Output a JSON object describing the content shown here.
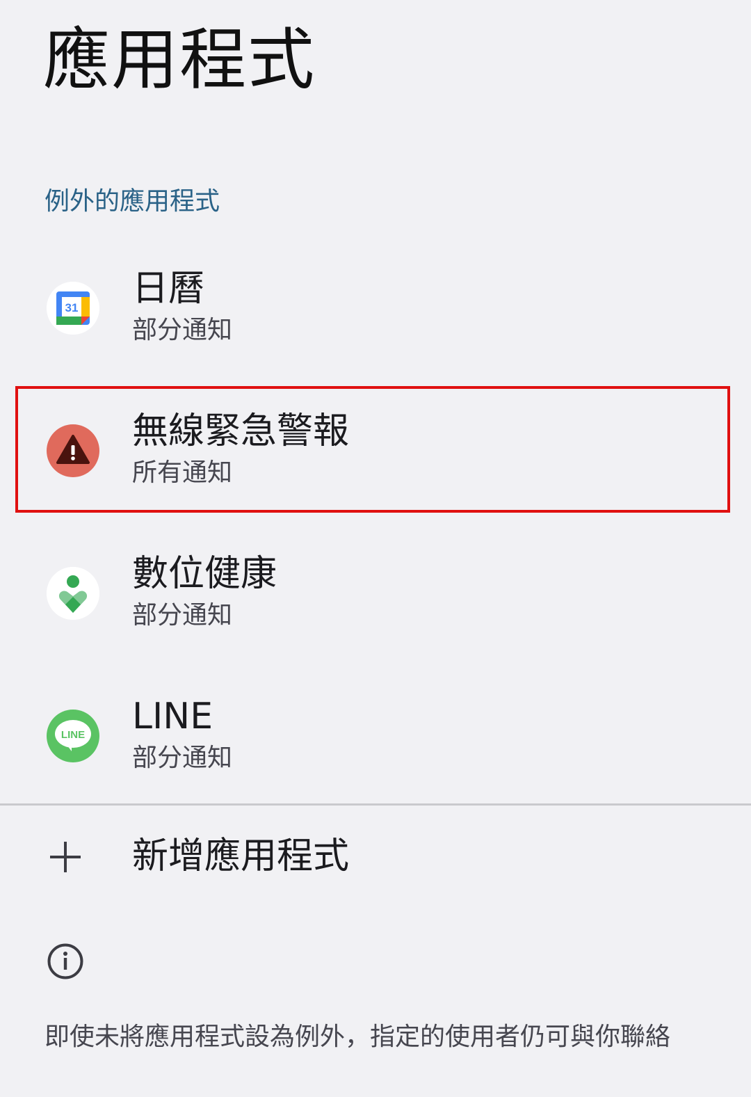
{
  "page": {
    "title": "應用程式"
  },
  "section": {
    "header": "例外的應用程式"
  },
  "apps": [
    {
      "name": "日曆",
      "status": "部分通知",
      "icon": "calendar-icon"
    },
    {
      "name": "無線緊急警報",
      "status": "所有通知",
      "icon": "emergency-alert-icon",
      "highlighted": true
    },
    {
      "name": "數位健康",
      "status": "部分通知",
      "icon": "digital-wellbeing-icon"
    },
    {
      "name": "LINE",
      "status": "部分通知",
      "icon": "line-icon"
    }
  ],
  "calendar_icon_text": "31",
  "line_icon_text": "LINE",
  "add_app": {
    "label": "新增應用程式",
    "icon": "plus-icon"
  },
  "info": {
    "icon": "info-icon",
    "text": "即使未將應用程式設為例外，指定的使用者仍可與你聯絡"
  },
  "colors": {
    "background": "#f1f1f4",
    "section_header": "#2a6287",
    "highlight_border": "#e01010",
    "alert_icon": "#e06a5c",
    "line_green": "#5ac363"
  }
}
